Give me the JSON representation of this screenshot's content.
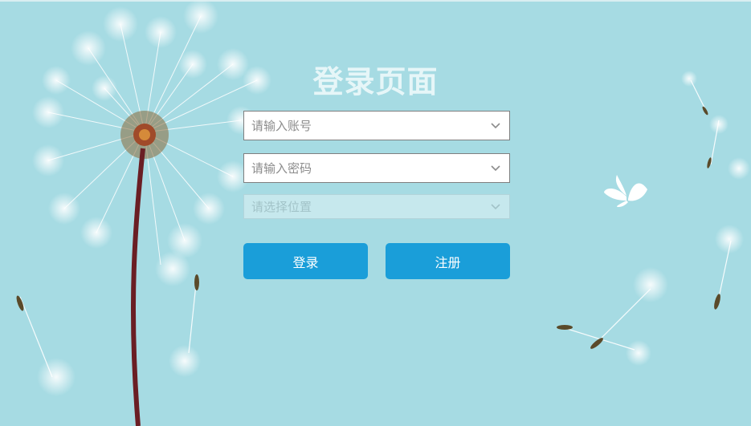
{
  "page": {
    "title": "登录页面",
    "background_color": "#a6dbe3",
    "accent_color": "#1a9ed9"
  },
  "form": {
    "account": {
      "placeholder": "请输入账号",
      "icon": "chevron-down-icon"
    },
    "password": {
      "placeholder": "请输入密码",
      "icon": "chevron-down-icon"
    },
    "location": {
      "placeholder": "请选择位置",
      "icon": "chevron-down-icon",
      "disabled": true
    }
  },
  "buttons": {
    "login_label": "登录",
    "register_label": "注册"
  },
  "decor": {
    "background": "dandelion-illustration",
    "butterfly": "butterfly-icon"
  }
}
